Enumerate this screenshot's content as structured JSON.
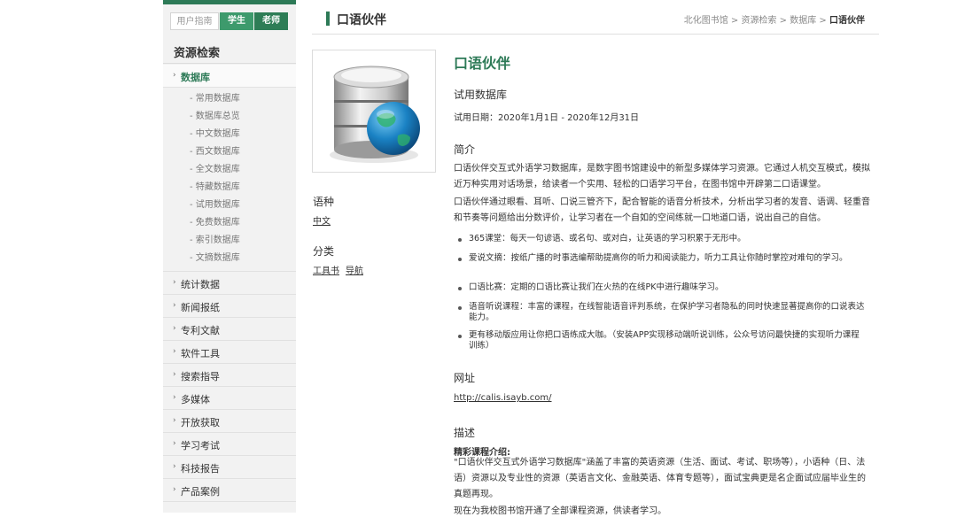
{
  "user_tabs": [
    "用户指南",
    "学生",
    "老师"
  ],
  "sidebar": {
    "title": "资源检索",
    "database": "数据库",
    "sub_items": [
      "常用数据库",
      "数据库总览",
      "中文数据库",
      "西文数据库",
      "全文数据库",
      "特藏数据库",
      "试用数据库",
      "免费数据库",
      "索引数据库",
      "文摘数据库"
    ],
    "sections": [
      "统计数据",
      "新闻报纸",
      "专利文献",
      "软件工具",
      "搜索指导",
      "多媒体",
      "开放获取",
      "学习考试",
      "科技报告",
      "产品案例"
    ]
  },
  "header": {
    "title": "口语伙伴",
    "breadcrumb": [
      "北化图书馆",
      "资源检索",
      "数据库",
      "口语伙伴"
    ]
  },
  "meta": {
    "lang_label": "语种",
    "lang_value": "中文",
    "cat_label": "分类",
    "cat_values": [
      "工具书",
      "导航"
    ]
  },
  "main": {
    "title": "口语伙伴",
    "type": "试用数据库",
    "trial_date": "试用日期：2020年1月1日 - 2020年12月31日",
    "intro_h": "简介",
    "intro_lines_1": [
      "口语伙伴交互式外语学习数据库，是数字图书馆建设中的新型多媒体学习资源。它通过人机交互模式，模拟",
      "近万种实用对话场景，给读者一个实用、轻松的口语学习平台，在图书馆中开辟第二口语课堂。"
    ],
    "intro_lines_2": [
      "口语伙伴通过眼看、耳听、口说三管齐下，配合智能的语音分析技术，分析出学习者的发音、语调、轻重音",
      "和节奏等问题给出分数评价，让学习者在一个自如的空间练就一口地道口语，说出自己的自信。"
    ],
    "features": [
      "365课堂：每天一句谚语、或名句、或对白，让英语的学习积累于无形中。",
      "爱说文摘：按纸广播的时事选编帮助提高你的听力和阅读能力，听力工具让你随时掌控对难句的学习。",
      "口语比赛：定期的口语比赛让我们在火热的在线PK中进行趣味学习。",
      "语音听说课程：丰富的课程，在线智能语音评判系统，在保护学习者隐私的同时快速显著提高你的口说表达能力。",
      "更有移动版应用让你把口语练成大咖。（安装APP实现移动端听说训练，公众号访问最快捷的实现听力课程训练）"
    ],
    "url_h": "网址",
    "url": "http://calis.isayb.com/",
    "desc_h": "描述",
    "desc_sub": "精彩课程介绍:",
    "desc_lines": [
      "\"口语伙伴交互式外语学习数据库\"涵盖了丰富的英语资源（生活、面试、考试、职场等），小语种（日、法",
      "语）资源以及专业性的资源（英语言文化、金融英语、体育专题等），面试宝典更是名企面试应届毕业生的",
      "真题再现。"
    ],
    "desc_tail": "现在为我校图书馆开通了全部课程资源，供读者学习。"
  },
  "colors": {
    "accent": "#2d7a57",
    "tab_student": "#3d9a6c",
    "tab_teacher": "#2e7d56"
  },
  "icons": {
    "db_image": "database-globe-icon",
    "bullet": "arrow-bullet-icon"
  }
}
